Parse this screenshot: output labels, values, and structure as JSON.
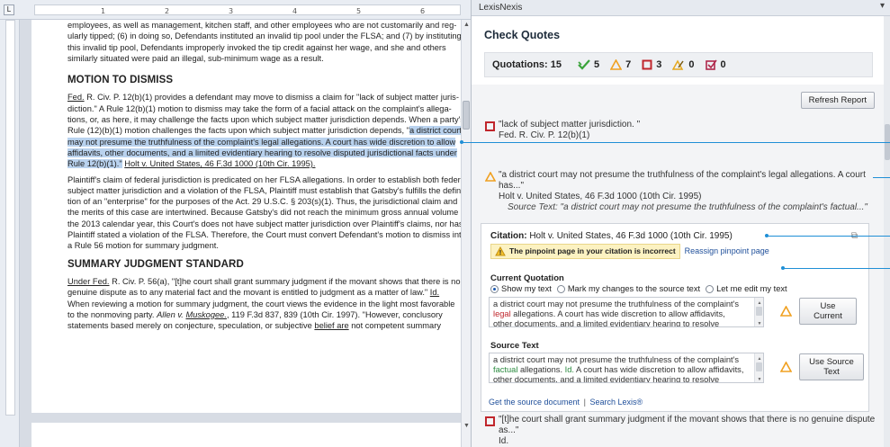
{
  "document": {
    "paragraph1": [
      "employees, as well as management, kitchen staff, and other employees who are not customarily and reg-",
      "ularly tipped; (6) in doing so, Defendants instituted an invalid tip pool under the FLSA; and (7) by instituting",
      "this invalid tip pool, Defendants improperly invoked the tip credit against her wage, and she and others",
      "similarly situated were paid an illegal, sub-minimum wage as a result."
    ],
    "heading1": "MOTION TO DISMISS",
    "p2": {
      "l1_a": "Fed.",
      "l1_b": " R. Civ. P. 12(b)(1) provides a defendant may move to dismiss a claim for \"lack of subject matter juris-",
      "l2": "diction.\" A Rule 12(b)(1) motion to dismiss may take the form of a facial attack on the complaint's allega-",
      "l3": "tions, or, as here, it may challenge the facts upon which subject matter jurisdiction depends. When a party's",
      "l4_a": "Rule (12)(b)(1) motion challenges the facts upon which subject matter jurisdiction depends, \"",
      "l4_hl": "a district court",
      "l5_hl": "may not presume the truthfulness of the complaint's legal allegations. A court has wide discretion to allow",
      "l6_hl": "affidavits, other documents, and a limited evidentiary hearing to resolve disputed jurisdictional facts under",
      "l7_hl": "Rule 12(b)(1).\"",
      "l7_cite": "Holt v. United States, 46 F.3d 1000 (10th Cir. 1995)."
    },
    "paragraph3": [
      "Plaintiff's claim of federal jurisdiction is predicated on her FLSA allegations. In order to establish both federal",
      "subject matter jurisdiction and a violation of the FLSA, Plaintiff must establish that Gatsby's fulfills the defini-",
      "tion of an \"enterprise\" for the purposes of the Act. 29 U.S.C. § 203(s)(1). Thus, the jurisdictional claim and",
      "the merits of this case are intertwined. Because Gatsby's did not reach the minimum gross annual volume in",
      "the 2013 calendar year, this Court's does not have subject matter jurisdiction over Plaintiff's claims, nor has",
      "Plaintiff stated a violation of the FLSA. Therefore, the Court must convert Defendant's motion to dismiss into",
      "a Rule 56 motion for summary judgment."
    ],
    "heading2": "SUMMARY JUDGMENT STANDARD",
    "p4": {
      "l1_a": "Under Fed.",
      "l1_b": " R. Civ. P. 56(a), \"[t]he court shall grant summary judgment if the movant shows that there is no",
      "l2_a": "genuine dispute as to any material fact and the movant is entitled to judgment as a matter of law.\" ",
      "l2_id": "Id.",
      "l3": "When reviewing a motion for summary judgment, the court views the evidence in the light most favorable",
      "l4_a": "to the nonmoving party. ",
      "l4_case": "Allen v. ",
      "l4_case2": "Muskogee.",
      "l4_b": ", 119 F.3d 837, 839 (10th Cir. 1997). \"However, conclusory",
      "l5_a": "statements based merely on conjecture, speculation, or subjective ",
      "l5_ul": "belief are",
      "l5_b": " not competent summary"
    }
  },
  "ruler": {
    "ticks": [
      "1",
      "2",
      "3",
      "4",
      "5",
      "6"
    ]
  },
  "pane": {
    "app_title": "LexisNexis",
    "title": "Check Quotes",
    "quotations_label": "Quotations: 15",
    "stats": [
      {
        "icon": "check-icon",
        "value": "5",
        "color": "#3aa33a"
      },
      {
        "icon": "warning-icon",
        "value": "7",
        "color": "#f0a020"
      },
      {
        "icon": "red-square-icon",
        "value": "3",
        "color": "#c0262c"
      },
      {
        "icon": "warning-pencil-icon",
        "value": "0",
        "color": "#e6a81e"
      },
      {
        "icon": "edit-check-icon",
        "value": "0",
        "color": "#b0284c"
      }
    ],
    "refresh_label": "Refresh Report",
    "results": [
      {
        "icon": "red-square-icon",
        "quote": "\"lack of subject matter jurisdiction. \"",
        "cite": "Fed. R. Civ. P. 12(b)(1)"
      },
      {
        "icon": "warning-icon",
        "quote": "\"a district court may not presume the truthfulness of the complaint's legal allegations. A court has...\"",
        "cite": "Holt v. United States, 46 F.3d 1000 (10th Cir. 1995)",
        "source": "Source Text: \"a district court may not presume the truthfulness of the complaint's factual...\""
      },
      {
        "icon": "red-square-icon",
        "quote": "\"[t]he court shall grant summary judgment if the movant shows that there is no genuine dispute as...\"",
        "cite": "Id."
      }
    ],
    "citation": {
      "label": "Citation:",
      "value": "Holt v. United States, 46 F.3d 1000 (10th Cir. 1995)",
      "warning": "The pinpoint page in your citation is incorrect",
      "reassign_link": "Reassign pinpoint page",
      "current_label": "Current Quotation",
      "radio_options": [
        "Show my text",
        "Mark my changes to the source text",
        "Let me edit my text"
      ],
      "current_text": {
        "l1": "a district court may not presume the truthfulness of the complaint's",
        "l2_red": "legal",
        "l2_rest": " allegations. A court has wide discretion to allow affidavits,",
        "l3": "other documents, and a limited evidentiary hearing to resolve"
      },
      "use_current_label": "Use Current",
      "source_label": "Source Text",
      "source_text": {
        "l1": "a district court may not presume the truthfulness of the complaint's",
        "l2_green": "factual",
        "l2_mid": " allegations. ",
        "l2_id": "Id.",
        "l2_rest": " A court has wide discretion to allow affidavits,",
        "l3": "other documents, and a limited evidentiary hearing to resolve"
      },
      "use_source_label": "Use Source Text",
      "link_source_doc": "Get the source document",
      "link_separator": "|",
      "link_search": "Search Lexis®"
    }
  },
  "colors": {
    "highlight": "#b9d2ee",
    "connector": "#1f8fd6",
    "link": "#1f4f9a"
  }
}
